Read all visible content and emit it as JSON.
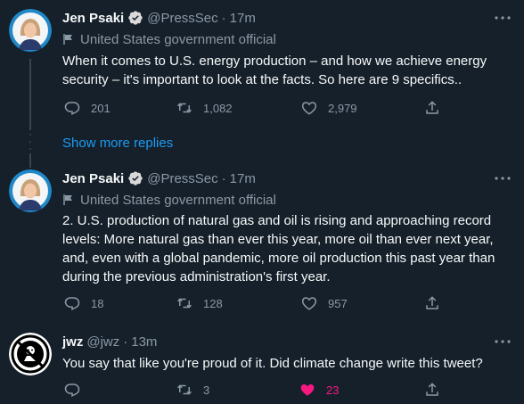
{
  "colors": {
    "background": "#15202b",
    "text_primary": "#f7f9f9",
    "text_secondary": "#8b98a5",
    "link": "#1d9bf0",
    "like": "#f91880",
    "verified": "#d9d9d9"
  },
  "tweets": [
    {
      "name": "Jen Psaki",
      "verified": true,
      "handle": "@PressSec",
      "separator": "·",
      "time": "17m",
      "label": "United States government official",
      "text": "When it comes to U.S. energy production – and how we achieve energy security – it's important to look at the facts. So here are 9 specifics..",
      "replies": "201",
      "retweets": "1,082",
      "likes": "2,979"
    },
    {
      "name": "Jen Psaki",
      "verified": true,
      "handle": "@PressSec",
      "separator": "·",
      "time": "17m",
      "label": "United States government official",
      "text": "2. U.S. production of natural gas and oil is rising and approaching record levels: More natural gas than ever this year, more oil than ever next year, and, even with a global pandemic, more oil production this past year than during the previous administration's first year.",
      "replies": "18",
      "retweets": "128",
      "likes": "957"
    },
    {
      "name": "jwz",
      "verified": false,
      "handle": "@jwz",
      "separator": "·",
      "time": "13m",
      "text": "You say that like you're proud of it. Did climate change write this tweet?",
      "replies": "",
      "retweets": "3",
      "likes": "23",
      "liked": true
    }
  ],
  "show_more_replies": "Show more replies",
  "icons": [
    "more-icon",
    "verified-icon",
    "government-flag-icon",
    "reply-icon",
    "retweet-icon",
    "like-icon",
    "share-icon"
  ]
}
